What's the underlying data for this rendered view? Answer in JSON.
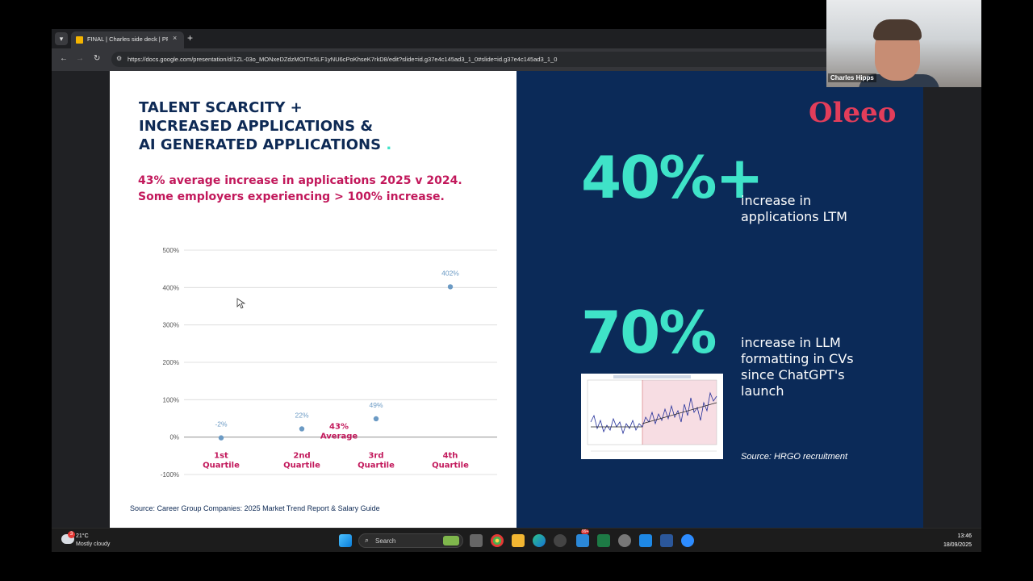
{
  "browser": {
    "tab_title": "FINAL | Charles side deck | PPt",
    "tab_close": "×",
    "new_tab": "+",
    "url": "https://docs.google.com/presentation/d/1ZL-03o_MONxeDZdzMOITIc5LF1yNU6cPoKhseK7rkD8/edit?slide=id.g37e4c145ad3_1_0#slide=id.g37e4c145ad3_1_0"
  },
  "slide_left": {
    "headline_lines": [
      "TALENT SCARCITY +",
      "INCREASED APPLICATIONS &",
      "AI GENERATED APPLICATIONS"
    ],
    "headline_dot": ".",
    "subtitle_lines": [
      "43% average increase in applications 2025 v 2024.",
      "Some employers experiencing > 100% increase."
    ],
    "source": "Source: Career Group Companies: 2025 Market Trend Report & Salary Guide"
  },
  "chart_data": {
    "type": "scatter",
    "categories": [
      "1st Quartile",
      "2nd Quartile",
      "3rd Quartile",
      "4th Quartile"
    ],
    "category_lines": [
      [
        "1st",
        "Quartile"
      ],
      [
        "2nd",
        "Quartile"
      ],
      [
        "3rd",
        "Quartile"
      ],
      [
        "4th",
        "Quartile"
      ]
    ],
    "values": [
      -2,
      22,
      49,
      402
    ],
    "data_labels": [
      "-2%",
      "22%",
      "49%",
      "402%"
    ],
    "y_ticks": [
      -100,
      0,
      100,
      200,
      300,
      400,
      500
    ],
    "y_tick_labels": [
      "-100%",
      "0%",
      "100%",
      "200%",
      "300%",
      "400%",
      "500%"
    ],
    "ylim": [
      -100,
      500
    ],
    "grid": true,
    "annotation": {
      "lines": [
        "43%",
        "Average"
      ],
      "value": 43,
      "position_between": [
        1,
        2
      ]
    },
    "colors": {
      "point": "#6b9ac4",
      "label": "#6b9ac4",
      "category": "#c2185b",
      "grid": "#d9d9d9",
      "zero": "#9e9e9e"
    }
  },
  "slide_right": {
    "logo": "Oleeo",
    "stat1": {
      "value": "40%+",
      "desc_lines": [
        "increase in",
        "applications LTM"
      ]
    },
    "stat2": {
      "value": "70%",
      "desc_lines": [
        "increase in LLM",
        "formatting in CVs",
        "since ChatGPT's",
        "launch"
      ]
    },
    "source": "Source: HRGO recruitment"
  },
  "taskbar": {
    "weather_badge": "3",
    "weather_temp": "21°C",
    "weather_cond": "Mostly cloudy",
    "search_label": "Search",
    "badge_99": "99+",
    "time": "13:46",
    "date": "18/09/2025"
  },
  "webcam": {
    "name": "Charles Hipps"
  },
  "colors": {
    "navy": "#0b2a58",
    "teal": "#3fe3c8",
    "magenta": "#c2185b",
    "logo": "#e23d5a"
  }
}
